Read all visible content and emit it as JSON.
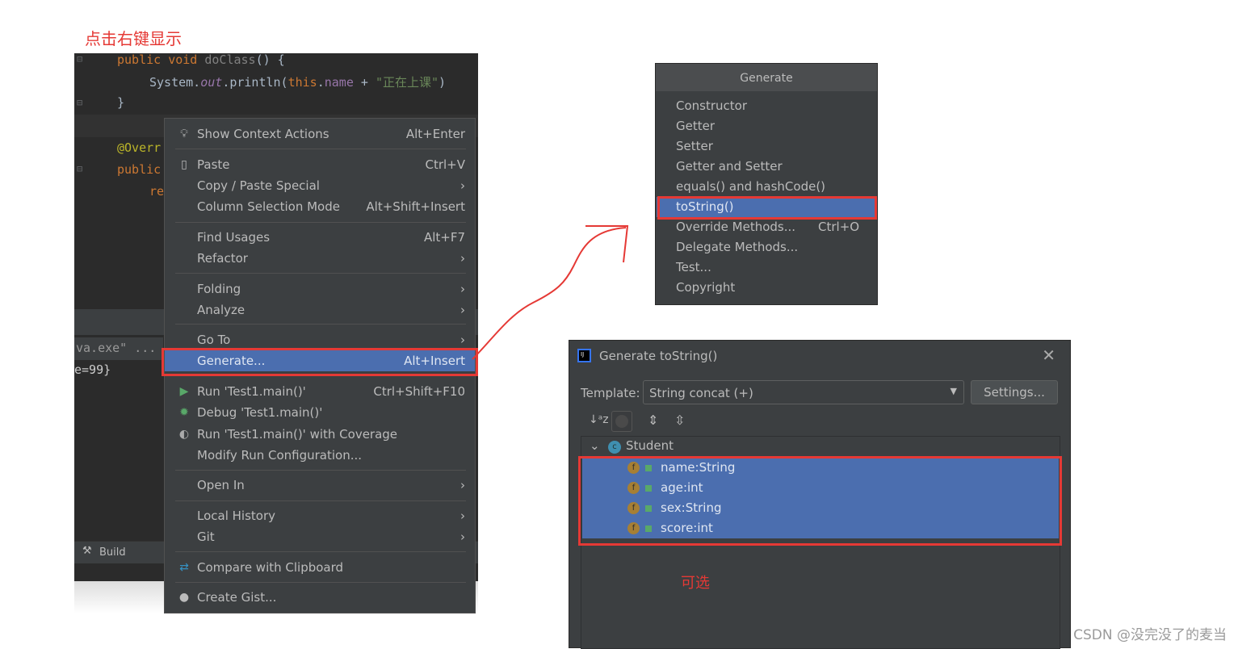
{
  "annotations": {
    "right_click_note": "点击右键显示",
    "optional_note": "可选",
    "watermark": "CSDN @没完没了的麦当"
  },
  "editor": {
    "line1": {
      "kw": "public void ",
      "fn": "doClass",
      "rest": "() {"
    },
    "line2": {
      "a": "System.",
      "b": "out",
      "c": ".println(",
      "d": "this",
      ".e": "",
      "e": ".",
      "f": "name",
      "g": " + ",
      "h": "\"正在上课\"",
      "i": ")"
    },
    "line3": "}",
    "line4": "@Overr",
    "line5": "public",
    "line6": "re",
    "console_cmd": "va.exe\" ...",
    "console_out": "e=99}",
    "build_tab": "Build"
  },
  "context_menu": {
    "items": [
      {
        "label": "Show Context Actions",
        "shortcut": "Alt+Enter",
        "icon": "bulb-icon"
      },
      {
        "label": "Paste",
        "shortcut": "Ctrl+V",
        "icon": "clipboard-icon"
      },
      {
        "label": "Copy / Paste Special",
        "shortcut": "›"
      },
      {
        "label": "Column Selection Mode",
        "shortcut": "Alt+Shift+Insert"
      },
      {
        "label": "Find Usages",
        "shortcut": "Alt+F7"
      },
      {
        "label": "Refactor",
        "shortcut": "›"
      },
      {
        "label": "Folding",
        "shortcut": "›"
      },
      {
        "label": "Analyze",
        "shortcut": "›"
      },
      {
        "label": "Go To",
        "shortcut": "›"
      },
      {
        "label": "Generate...",
        "shortcut": "Alt+Insert",
        "selected": true
      },
      {
        "label": "Run 'Test1.main()'",
        "shortcut": "Ctrl+Shift+F10",
        "icon": "run-icon"
      },
      {
        "label": "Debug 'Test1.main()'",
        "shortcut": "",
        "icon": "debug-icon"
      },
      {
        "label": "Run 'Test1.main()' with Coverage",
        "shortcut": "",
        "icon": "coverage-icon"
      },
      {
        "label": "Modify Run Configuration...",
        "shortcut": ""
      },
      {
        "label": "Open In",
        "shortcut": "›"
      },
      {
        "label": "Local History",
        "shortcut": "›"
      },
      {
        "label": "Git",
        "shortcut": "›"
      },
      {
        "label": "Compare with Clipboard",
        "shortcut": "",
        "icon": "compare-icon"
      },
      {
        "label": "Create Gist...",
        "shortcut": "",
        "icon": "github-icon"
      }
    ]
  },
  "generate_popup": {
    "title": "Generate",
    "items": [
      {
        "label": "Constructor"
      },
      {
        "label": "Getter"
      },
      {
        "label": "Setter"
      },
      {
        "label": "Getter and Setter"
      },
      {
        "label": "equals() and hashCode()"
      },
      {
        "label": "toString()",
        "selected": true
      },
      {
        "label": "Override Methods...",
        "shortcut": "Ctrl+O"
      },
      {
        "label": "Delegate Methods..."
      },
      {
        "label": "Test..."
      },
      {
        "label": "Copyright"
      }
    ]
  },
  "dialog": {
    "title": "Generate toString()",
    "template_label": "Template:",
    "template_value": "String concat (+)",
    "settings_button": "Settings...",
    "class_name": "Student",
    "fields": [
      {
        "label": "name:String"
      },
      {
        "label": "age:int"
      },
      {
        "label": "sex:String"
      },
      {
        "label": "score:int"
      }
    ]
  },
  "colors": {
    "accent": "#4b6eaf",
    "annotation_red": "#e53935",
    "menu_bg": "#3c3f41",
    "editor_bg": "#2b2b2b"
  }
}
